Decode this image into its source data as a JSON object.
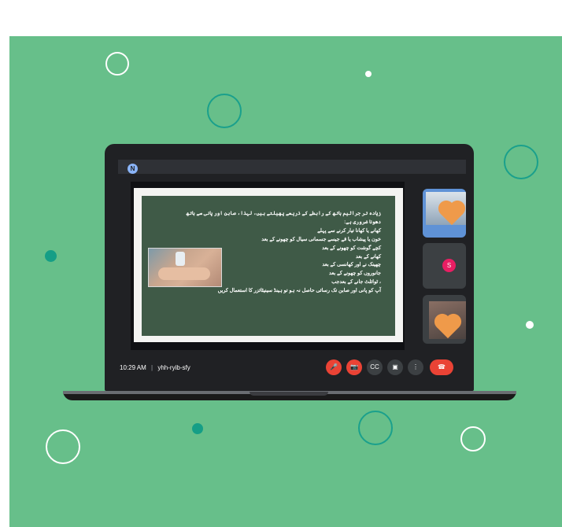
{
  "meeting": {
    "time": "10:29 AM",
    "separator": "|",
    "code": "yhh-ryib-sfy",
    "top_avatar_initial": "N"
  },
  "slide": {
    "lines": [
      "زیادہ تر جراثیم ہاتھ کے رابطے کے ذریعے پھیلتے ہیں، لہذا، صابن اور پانی سے ہاتھ",
      "دھونا ضروری ہے:",
      "کھانے یا کھانا تیار کرنے سے پہلے",
      "خون یا پیشاب یا قے جیسے جسمانی سیال کو چھونے کے بعد",
      "کچے گوشت کو چھونے کے بعد",
      "کھانے کے بعد",
      "چھینک نے اور کھانسی کے بعد",
      "جانوروں کو چھونے کے بعد",
      "، ٹوائلٹ جانے کے بعدجب",
      "آپ کو پانی اور صابن تک رسائی حاصل نہ ہو تو ہینڈ سینیٹائزر کا استعمال کریں"
    ]
  },
  "participants": {
    "s_initial": "S"
  },
  "controls": {
    "mic_icon": "🎤",
    "cam_icon": "📷",
    "cc_icon": "CC",
    "present_icon": "▣",
    "more_icon": "⋮",
    "hangup_icon": "☎"
  },
  "colors": {
    "background_green": "#67bf8a",
    "meet_dark": "#202124",
    "red_control": "#ea4335",
    "slide_green": "#3f5a47"
  }
}
